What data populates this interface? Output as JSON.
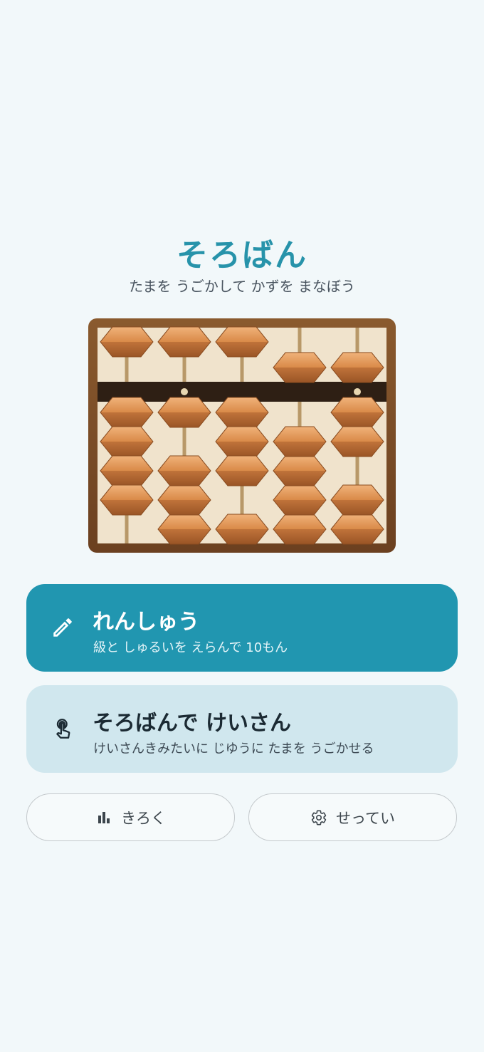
{
  "app": {
    "title": "そろばん",
    "subtitle": "たまを うごかして かずを まなぼう"
  },
  "abacus": {
    "rods": [
      {
        "heaven": 0,
        "earth": 4
      },
      {
        "heaven": 0,
        "earth": 1
      },
      {
        "heaven": 0,
        "earth": 3
      },
      {
        "heaven": 1,
        "earth": 0
      },
      {
        "heaven": 1,
        "earth": 2
      }
    ],
    "colors": {
      "frame": "#7a4a22",
      "board": "#f0e3cc",
      "beam": "#2e1f14",
      "bead": "#c97a3a",
      "rod": "#b89868"
    }
  },
  "menu": {
    "practice": {
      "title": "れんしゅう",
      "subtitle": "級と しゅるいを えらんで 10もん",
      "icon": "pencil-icon",
      "color": "#2196b0"
    },
    "free_calc": {
      "title": "そろばんで けいさん",
      "subtitle": "けいさんきみたいに じゆうに たまを うごかせる",
      "icon": "touch-icon",
      "color": "#d0e7ee"
    }
  },
  "buttons": {
    "records": {
      "label": "きろく",
      "icon": "bar-chart-icon"
    },
    "settings": {
      "label": "せってい",
      "icon": "gear-icon"
    }
  }
}
